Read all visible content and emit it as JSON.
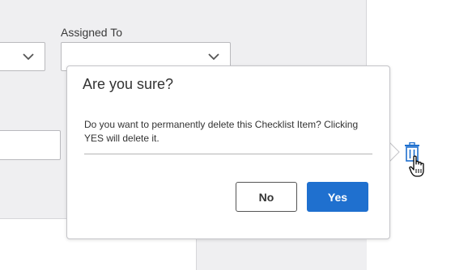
{
  "form": {
    "assigned_to_label": "Assigned To"
  },
  "dialog": {
    "title": "Are you sure?",
    "message": "Do you want to permanently delete this Checklist Item? Clicking YES will delete it.",
    "no_label": "No",
    "yes_label": "Yes"
  },
  "icons": {
    "trash": "trash-icon",
    "cursor": "hand-pointer-cursor",
    "dropdown": "chevron-down-icon"
  },
  "colors": {
    "primary": "#1f70cf",
    "trash_icon": "#1f70cf",
    "background_panel": "#efeff1"
  }
}
